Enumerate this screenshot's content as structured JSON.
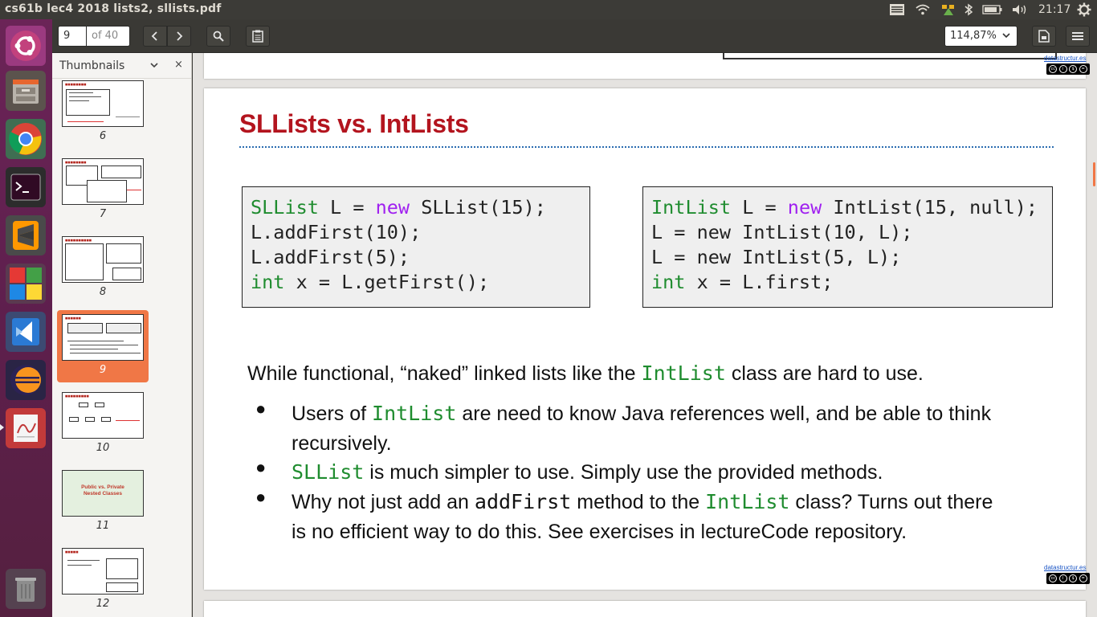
{
  "window": {
    "title": "cs61b lec4 2018 lists2, sllists.pdf"
  },
  "system": {
    "clock": "21:17"
  },
  "toolbar": {
    "page_current": "9",
    "page_total": "of 40",
    "zoom": "114,87%"
  },
  "sidebar": {
    "title": "Thumbnails",
    "thumbnails": [
      {
        "page": "6"
      },
      {
        "page": "7"
      },
      {
        "page": "8"
      },
      {
        "page": "9",
        "selected": true
      },
      {
        "page": "10"
      },
      {
        "page": "11",
        "text": "Public vs. Private\nNested Classes"
      },
      {
        "page": "12"
      }
    ]
  },
  "slide": {
    "title": "SLLists vs. IntLists",
    "code_left": {
      "line1_type": "SLList",
      "line1_a": " L = ",
      "line1_new": "new",
      "line1_b": " SLList(15);",
      "line2": "L.addFirst(10);",
      "line3": "L.addFirst(5);",
      "line4_type": "int",
      "line4_rest": " x = L.getFirst();"
    },
    "code_right": {
      "line1_type": "IntList",
      "line1_a": " L = ",
      "line1_new": "new",
      "line1_b": " IntList(15, null);",
      "line2": "L = new IntList(10, L);",
      "line3": "L = new IntList(5, L);",
      "line4_type": "int",
      "line4_rest": " x = L.first;"
    },
    "lead": {
      "before": "While functional, “naked” linked lists like the ",
      "code": "IntList",
      "after": " class are hard to use."
    },
    "bullets": {
      "b1_before": "Users of ",
      "b1_code": "IntList",
      "b1_after": " are need to know Java references well, and be able to think",
      "b1_line2": "recursively.",
      "b2_code": "SLList",
      "b2_after": " is much simpler to use. Simply use the provided methods.",
      "b3_before": "Why not just add an ",
      "b3_code": "addFirst",
      "b3_mid": " method to the ",
      "b3_code2": "IntList",
      "b3_after": " class? Turns out there",
      "b3_line2": "is no efficient way to do this. See exercises in lectureCode repository."
    },
    "footer_link": "datastructur.es"
  },
  "prev_page": {
    "footer_link": "datastructur.es"
  },
  "colors": {
    "title_red": "#b3141e",
    "type_green": "#1f8c2f",
    "keyword_purple": "#a020f0",
    "accent_orange": "#f07746"
  }
}
